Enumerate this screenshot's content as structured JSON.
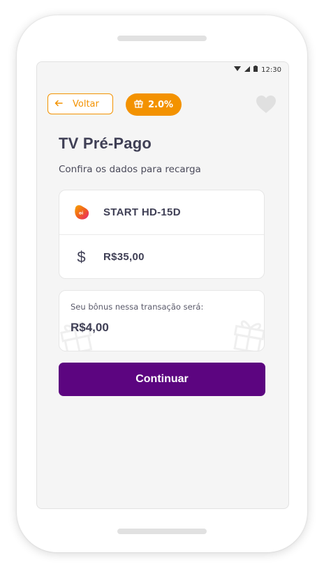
{
  "status_bar": {
    "time": "12:30",
    "icons": [
      "wifi-icon",
      "signal-icon",
      "battery-icon"
    ]
  },
  "header": {
    "back_label": "Voltar",
    "back_icon": "arrow-left-icon",
    "bonus_percent": "2.0%",
    "bonus_icon": "gift-icon",
    "favorite_icon": "heart-icon"
  },
  "page": {
    "title": "TV Pré-Pago",
    "subtitle": "Confira os dados para recarga"
  },
  "recharge": {
    "operator_icon": "oi-logo",
    "plan": "START HD-15D",
    "currency_icon": "dollar-icon",
    "amount": "R$35,00"
  },
  "bonus": {
    "label": "Seu bônus nessa transação será:",
    "value": "R$4,00"
  },
  "continue_label": "Continuar",
  "colors": {
    "accent": "#f39200",
    "primary": "#5c0580",
    "text": "#3f3f55"
  }
}
